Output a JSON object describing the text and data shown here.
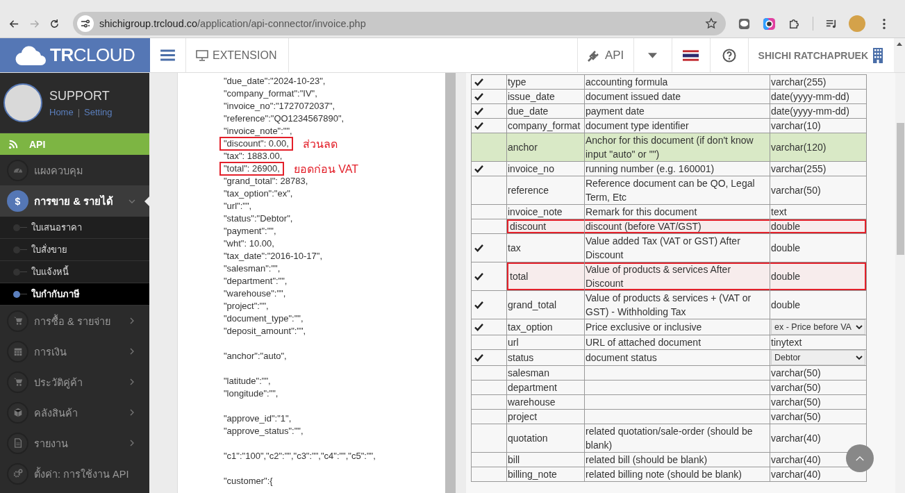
{
  "browser": {
    "url_host": "shichigroup.trcloud.co",
    "url_path": "/application/api-connector/invoice.php"
  },
  "header": {
    "logo_bold": "TR",
    "logo_rest": "CLOUD",
    "extension": "EXTENSION",
    "api": "API",
    "user": "SHICHI RATCHAPRUEK"
  },
  "profile": {
    "name": "SUPPORT",
    "home": "Home",
    "separator": "|",
    "setting": "Setting"
  },
  "sidebar": {
    "items": [
      {
        "label": "API",
        "selected": true,
        "expanded": false,
        "has_arrow": false
      },
      {
        "label": "แผงควบคุม",
        "selected": false,
        "expanded": false,
        "has_arrow": false
      },
      {
        "label": "การขาย & รายได้",
        "badge": "$",
        "selected": false,
        "expanded": true,
        "has_arrow": true,
        "children": [
          {
            "label": "ใบเสนอราคา",
            "selected": false
          },
          {
            "label": "ใบสั่งขาย",
            "selected": false
          },
          {
            "label": "ใบแจ้งหนี้",
            "selected": false
          },
          {
            "label": "ใบกำกับภาษี",
            "selected": true
          }
        ]
      },
      {
        "label": "การซื้อ & รายจ่าย",
        "selected": false,
        "expanded": false,
        "has_arrow": true
      },
      {
        "label": "การเงิน",
        "selected": false,
        "expanded": false,
        "has_arrow": true
      },
      {
        "label": "ประวัติคู่ค้า",
        "selected": false,
        "expanded": false,
        "has_arrow": true
      },
      {
        "label": "คลังสินค้า",
        "selected": false,
        "expanded": false,
        "has_arrow": true
      },
      {
        "label": "รายงาน",
        "selected": false,
        "expanded": false,
        "has_arrow": true
      },
      {
        "label": "ตั้งค่า: การใช้งาน API",
        "selected": false,
        "expanded": false,
        "has_arrow": false
      }
    ]
  },
  "code_blocks": [
    [
      {
        "text": "\"due_date\":\"2024-10-23\",",
        "boxed": false
      },
      {
        "text": "\"company_format\":\"IV\",",
        "boxed": false
      },
      {
        "text": "\"invoice_no\":\"1727072037\",",
        "boxed": false
      },
      {
        "text": "\"reference\":\"QO1234567890\",",
        "boxed": false
      },
      {
        "text": "\"invoice_note\":\"\",",
        "boxed": false
      },
      {
        "text": "\"discount\": 0.00,",
        "boxed": true,
        "note": "ส่วนลด"
      },
      {
        "text": "\"tax\": 1883.00,",
        "boxed": false
      },
      {
        "text": "\"total\": 26900,",
        "boxed": true,
        "note": "ยอดก่อน VAT"
      },
      {
        "text": "\"grand_total\": 28783,",
        "boxed": false
      },
      {
        "text": "\"tax_option\":\"ex\",",
        "boxed": false
      },
      {
        "text": "\"url\":\"\",",
        "boxed": false
      },
      {
        "text": "\"status\":\"Debtor\",",
        "boxed": false
      },
      {
        "text": "\"payment\":\"\",",
        "boxed": false
      },
      {
        "text": "\"wht\": 10.00,",
        "boxed": false
      },
      {
        "text": "\"tax_date\":\"2016-10-17\",",
        "boxed": false
      },
      {
        "text": "\"salesman\":\"\",",
        "boxed": false
      },
      {
        "text": "\"department\":\"\",",
        "boxed": false
      },
      {
        "text": "\"warehouse\":\"\",",
        "boxed": false
      },
      {
        "text": "\"project\":\"\",",
        "boxed": false
      },
      {
        "text": "\"document_type\":\"\",",
        "boxed": false
      },
      {
        "text": "\"deposit_amount\":\"\",",
        "boxed": false
      }
    ],
    [
      {
        "text": "\"anchor\":\"auto\",",
        "boxed": false
      }
    ],
    [
      {
        "text": "\"latitude\":\"\",",
        "boxed": false
      },
      {
        "text": "\"longitude\":\"\",",
        "boxed": false
      }
    ],
    [
      {
        "text": "\"approve_id\":\"1\",",
        "boxed": false
      },
      {
        "text": "\"approve_status\":\"\",",
        "boxed": false
      }
    ],
    [
      {
        "text": "\"c1\":\"100\",\"c2\":\"\",\"c3\":\"\",\"c4\":\"\",\"c5\":\"\",",
        "boxed": false
      }
    ],
    [
      {
        "text": "\"customer\":{",
        "boxed": false
      }
    ]
  ],
  "table": {
    "rows": [
      {
        "required": true,
        "name": "type",
        "description": "accounting formula",
        "type": "varchar(255)",
        "kind": "text",
        "highlighted": false,
        "outlined": false
      },
      {
        "required": true,
        "name": "issue_date",
        "description": "document issued date",
        "type": "date(yyyy-mm-dd)",
        "kind": "text",
        "highlighted": false,
        "outlined": false
      },
      {
        "required": true,
        "name": "due_date",
        "description": "payment date",
        "type": "date(yyyy-mm-dd)",
        "kind": "text",
        "highlighted": false,
        "outlined": false
      },
      {
        "required": true,
        "name": "company_format",
        "description": "document type identifier",
        "type": "varchar(10)",
        "kind": "text",
        "highlighted": false,
        "outlined": false
      },
      {
        "required": false,
        "name": "anchor",
        "description": "Anchor for this document (if don't know input \"auto\" or \"\")",
        "type": "varchar(120)",
        "kind": "text",
        "highlighted": true,
        "outlined": false
      },
      {
        "required": true,
        "name": "invoice_no",
        "description": "running number (e.g. 160001)",
        "type": "varchar(255)",
        "kind": "text",
        "highlighted": false,
        "outlined": false
      },
      {
        "required": false,
        "name": "reference",
        "description": "Reference document can be QO, Legal Term, Etc",
        "type": "varchar(50)",
        "kind": "text",
        "highlighted": false,
        "outlined": false
      },
      {
        "required": false,
        "name": "invoice_note",
        "description": "Remark for this document",
        "type": "text",
        "kind": "text",
        "highlighted": false,
        "outlined": false
      },
      {
        "required": false,
        "name": "discount",
        "description": "discount (before VAT/GST)",
        "type": "double",
        "kind": "text",
        "highlighted": false,
        "outlined": true
      },
      {
        "required": true,
        "name": "tax",
        "description": "Value added Tax (VAT or GST) After Discount",
        "type": "double",
        "kind": "text",
        "highlighted": false,
        "outlined": false
      },
      {
        "required": true,
        "name": "total",
        "description": "Value of products & services After Discount",
        "type": "double",
        "kind": "text",
        "highlighted": false,
        "outlined": true
      },
      {
        "required": true,
        "name": "grand_total",
        "description": "Value of products & services + (VAT or GST) - Withholding Tax",
        "type": "double",
        "kind": "text",
        "highlighted": false,
        "outlined": false
      },
      {
        "required": true,
        "name": "tax_option",
        "description": "Price exclusive or inclusive",
        "type": "ex - Price before VA",
        "kind": "select",
        "highlighted": false,
        "outlined": false
      },
      {
        "required": false,
        "name": "url",
        "description": "URL of attached document",
        "type": "tinytext",
        "kind": "text",
        "highlighted": false,
        "outlined": false
      },
      {
        "required": true,
        "name": "status",
        "description": "document status",
        "type": "Debtor",
        "kind": "select",
        "highlighted": false,
        "outlined": false
      },
      {
        "required": false,
        "name": "salesman",
        "type": "varchar(50)",
        "kind": "text",
        "highlighted": false,
        "outlined": false
      },
      {
        "required": false,
        "name": "department",
        "type": "varchar(50)",
        "kind": "text",
        "highlighted": false,
        "outlined": false
      },
      {
        "required": false,
        "name": "warehouse",
        "type": "varchar(50)",
        "kind": "text",
        "highlighted": false,
        "outlined": false
      },
      {
        "required": false,
        "name": "project",
        "type": "varchar(50)",
        "kind": "text",
        "highlighted": false,
        "outlined": false
      },
      {
        "required": false,
        "name": "quotation",
        "description": "related quotation/sale-order (should be blank)",
        "type": "varchar(40)",
        "kind": "text",
        "highlighted": false,
        "outlined": false
      },
      {
        "required": false,
        "name": "bill",
        "description": "related bill (should be blank)",
        "type": "varchar(40)",
        "kind": "text",
        "highlighted": false,
        "outlined": false
      },
      {
        "required": false,
        "name": "billing_note",
        "description": "related billing note (should be blank)",
        "type": "varchar(40)",
        "kind": "text",
        "highlighted": false,
        "outlined": false
      }
    ]
  }
}
